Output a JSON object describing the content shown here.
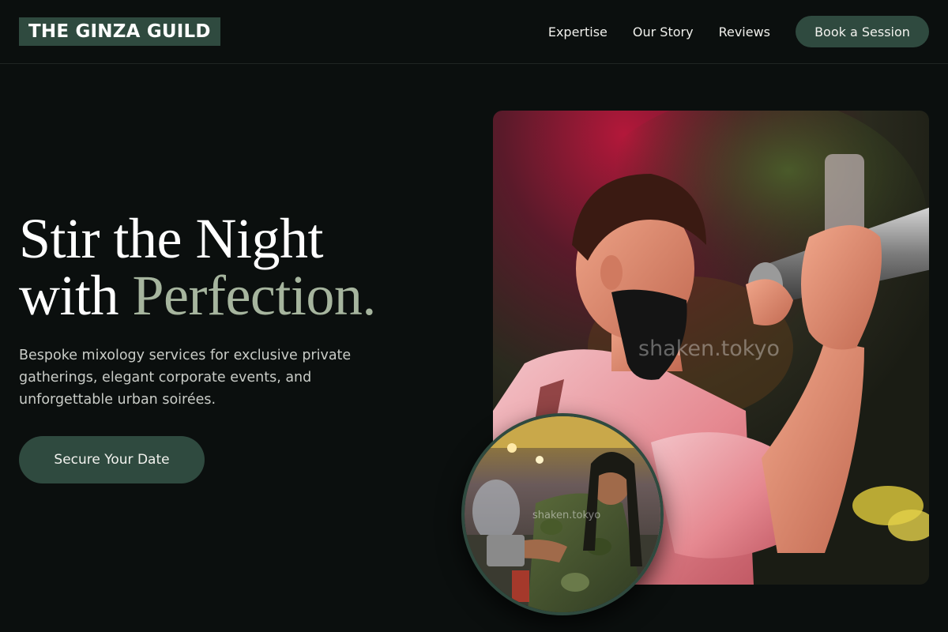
{
  "header": {
    "logo": "THE GINZA GUILD",
    "nav": [
      "Expertise",
      "Our Story",
      "Reviews"
    ],
    "cta": "Book a Session"
  },
  "hero": {
    "title_line1": "Stir the Night",
    "title_line2_prefix": "with ",
    "title_line2_accent": "Perfection.",
    "subtitle": "Bespoke mixology services for exclusive private gatherings, elegant corporate events, and unforgettable urban soirées.",
    "cta": "Secure Your Date"
  },
  "images": {
    "main_watermark": "shaken.tokyo",
    "inset_watermark": "shaken.tokyo"
  },
  "colors": {
    "background": "#0b0f0e",
    "accent_green": "#2f4a3f",
    "accent_text": "#a6b59e"
  }
}
